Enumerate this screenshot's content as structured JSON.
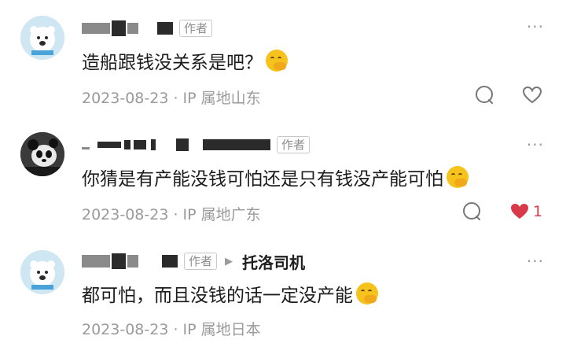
{
  "comments": [
    {
      "author_tag": "作者",
      "text": "造船跟钱没关系是吧？",
      "meta": "2023-08-23 · IP 属地山东",
      "more": "···"
    },
    {
      "author_tag": "作者",
      "text": "你猜是有产能没钱可怕还是只有钱没产能可怕",
      "meta": "2023-08-23 · IP 属地广东",
      "more": "···",
      "like_count": "1"
    },
    {
      "author_tag": "作者",
      "reply_arrow": "▶",
      "reply_to": "托洛司机",
      "text": "都可怕，而且没钱的话一定没产能",
      "meta": "2023-08-23 · IP 属地日本",
      "more": "···"
    }
  ],
  "colors": {
    "meta_gray": "#9a9a9a",
    "like_red": "#d93a4a",
    "emoji_yellow": "#f6c21c"
  },
  "icons": [
    "comment-icon",
    "heart-icon",
    "heart-filled-icon",
    "more-icon",
    "blush-emoji-icon"
  ]
}
